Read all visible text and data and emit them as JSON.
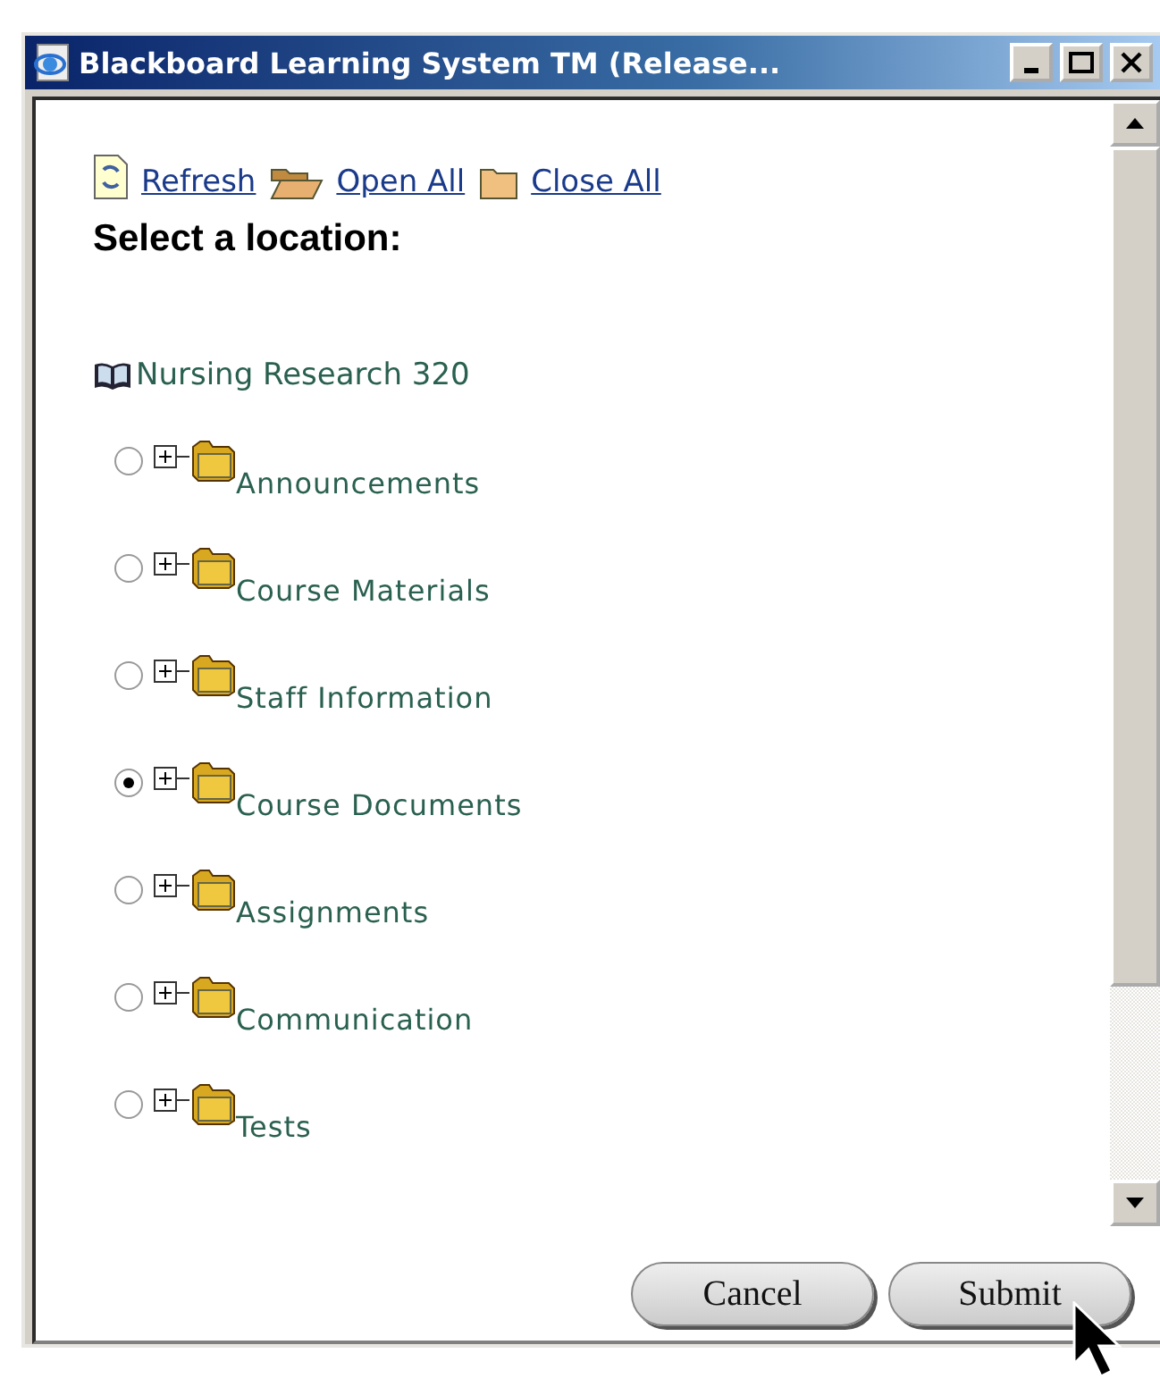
{
  "window": {
    "title": "Blackboard Learning System TM (Release..."
  },
  "toolbar": [
    {
      "kind": "refresh",
      "label": "Refresh"
    },
    {
      "kind": "open",
      "label": "Open All"
    },
    {
      "kind": "close",
      "label": "Close All"
    }
  ],
  "heading": "Select a location",
  "heading_suffix": ":",
  "course": "Nursing Research 320",
  "locations": [
    {
      "label": "Announcements",
      "selected": false
    },
    {
      "label": "Course Materials",
      "selected": false
    },
    {
      "label": "Staff Information",
      "selected": false
    },
    {
      "label": "Course Documents",
      "selected": true
    },
    {
      "label": "Assignments",
      "selected": false
    },
    {
      "label": "Communication",
      "selected": false
    },
    {
      "label": "Tests",
      "selected": false
    }
  ],
  "buttons": [
    {
      "label": "Cancel"
    },
    {
      "label": "Submit"
    }
  ]
}
